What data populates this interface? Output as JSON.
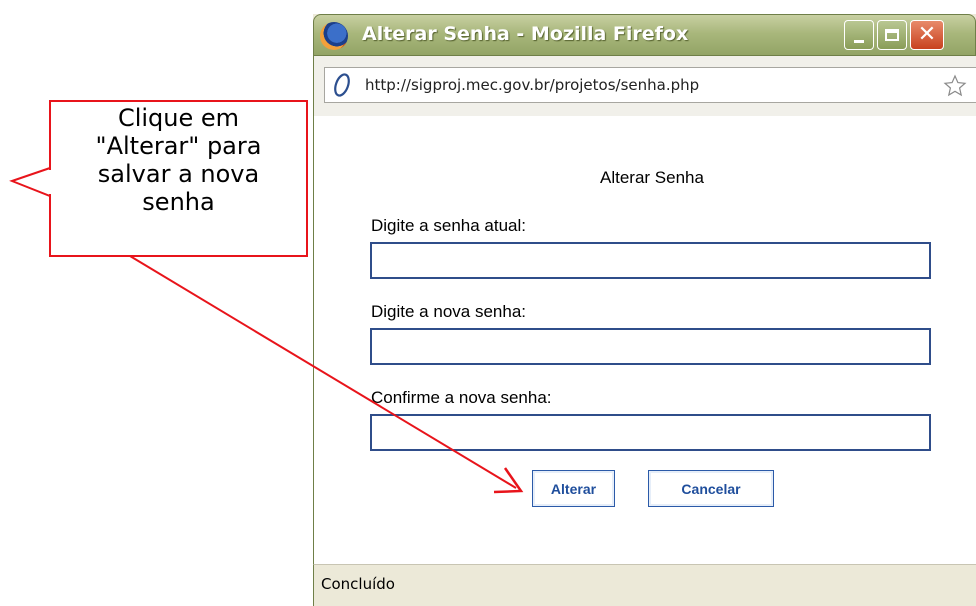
{
  "window": {
    "title": "Alterar Senha - Mozilla Firefox",
    "url": "http://sigproj.mec.gov.br/projetos/senha.php",
    "status": "Concluído"
  },
  "form": {
    "title": "Alterar Senha",
    "current_password_label": "Digite a senha atual:",
    "new_password_label": "Digite a nova senha:",
    "confirm_password_label": "Confirme a nova senha:",
    "current_password_value": "",
    "new_password_value": "",
    "confirm_password_value": "",
    "submit_label": "Alterar",
    "cancel_label": "Cancelar"
  },
  "callout": {
    "text_line1": "Clique em",
    "text_line2": "\"Alterar\" para",
    "text_line3": "salvar a nova",
    "text_line4": "senha"
  },
  "icons": {
    "browser_logo": "firefox-icon",
    "page_icon": "page-icon",
    "bookmark": "star-icon",
    "minimize": "minimize-icon",
    "maximize": "maximize-icon",
    "close": "close-icon"
  },
  "colors": {
    "callout_border": "#e8141b",
    "input_border": "#2f4d8a",
    "button_text": "#1f4e9c"
  }
}
